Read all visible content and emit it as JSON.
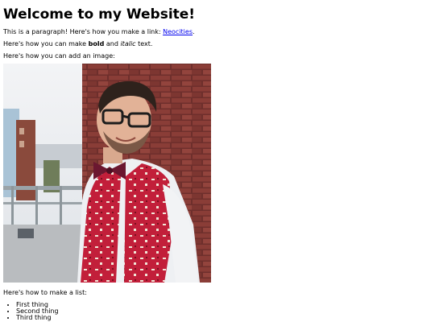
{
  "heading": "Welcome to my Website!",
  "paragraph1": {
    "before_link": "This is a paragraph! Here's how you make a link: ",
    "link_text": "Neocities",
    "after_link": "."
  },
  "paragraph2": {
    "before_bold": "Here's how you can make ",
    "bold_text": "bold",
    "middle": " and ",
    "italic_text": "italic",
    "after": " text."
  },
  "paragraph3": "Here's how you can add an image:",
  "image": {
    "alt": "photo of a smiling man with glasses, a bow tie and a red patterned vest leaning against a brick wall"
  },
  "paragraph4": "Here's how to make a list:",
  "list_items": [
    "First thing",
    "Second thing",
    "Third thing"
  ],
  "colors": {
    "link": "#0000ee",
    "text": "#000000",
    "background": "#ffffff"
  }
}
